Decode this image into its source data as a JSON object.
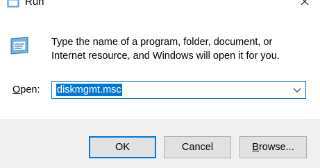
{
  "window": {
    "title": "Run",
    "title_icon": "run-icon",
    "close_icon": "close-icon"
  },
  "description": {
    "line1": "Type the name of a program, folder, document, or",
    "line2": "Internet resource, and Windows will open it for you."
  },
  "open_field": {
    "label_first": "O",
    "label_rest": "pen:",
    "value": "diskmgmt.msc",
    "dropdown_icon": "chevron-down-icon"
  },
  "buttons": {
    "ok": "OK",
    "cancel": "Cancel",
    "browse_first": "B",
    "browse_rest": "rowse..."
  },
  "colors": {
    "accent": "#0078d7",
    "button_bg": "#e1e1e1",
    "footer_bg": "#f0f0f0"
  }
}
